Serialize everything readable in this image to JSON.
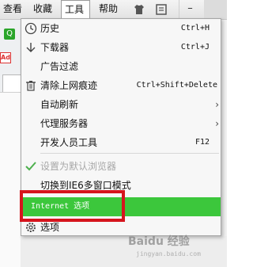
{
  "menubar": {
    "items": [
      "查看",
      "收藏",
      "工具",
      "帮助"
    ],
    "active_index": 2,
    "shirt_icon": "shirt-icon",
    "settings_icon": "settings-icon",
    "minimize_label": "–"
  },
  "background": {
    "address_icon_label": "Q",
    "ad_icon_label": "Ad"
  },
  "dropdown": {
    "items": [
      {
        "icon": "clock-icon",
        "label": "历史",
        "shortcut": "Ctrl+H"
      },
      {
        "icon": "download-arrow-icon",
        "label": "下载器",
        "shortcut": "Ctrl+J"
      },
      {
        "icon": "",
        "label": "广告过滤",
        "shortcut": ""
      },
      {
        "icon": "trash-icon",
        "label": "清除上网痕迹",
        "shortcut": "Ctrl+Shift+Delete"
      },
      {
        "icon": "",
        "label": "自动刷新",
        "submenu": true
      },
      {
        "icon": "",
        "label": "代理服务器",
        "submenu": true
      },
      {
        "icon": "",
        "label": "开发人员工具",
        "shortcut": "F12"
      },
      {
        "icon": "checkmark-icon",
        "label": "设置为默认浏览器",
        "disabled": true
      },
      {
        "icon": "",
        "label": "切换到IE6多窗口模式"
      },
      {
        "icon": "",
        "label": "Internet 选项",
        "highlighted": true
      },
      {
        "icon": "gear-icon",
        "label": "选项"
      }
    ]
  },
  "watermark": {
    "text": "Baidu 经验",
    "sub": "jingyan.baidu.com"
  },
  "colors": {
    "highlight": "#3cc73c",
    "annotation": "#d6151d"
  }
}
